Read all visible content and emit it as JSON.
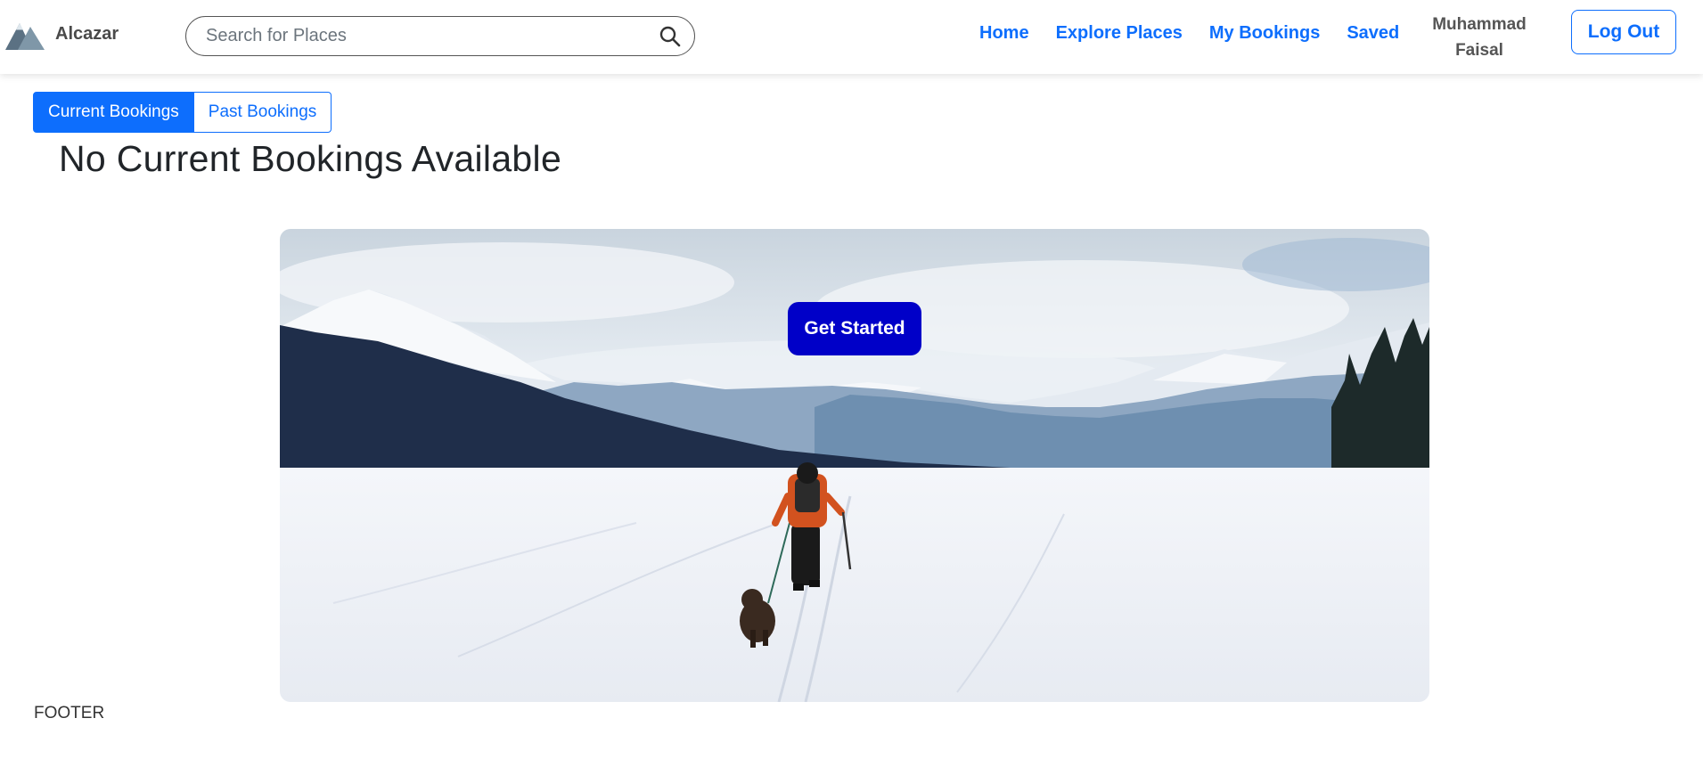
{
  "navbar": {
    "brand_name": "Alcazar",
    "search": {
      "placeholder": "Search for Places",
      "value": ""
    },
    "links": [
      "Home",
      "Explore Places",
      "My Bookings",
      "Saved"
    ],
    "user_name": "Muhammad Faisal",
    "logout_label": "Log Out"
  },
  "tabs": [
    "Current Bookings",
    "Past Bookings"
  ],
  "active_tab": "Current Bookings",
  "main": {
    "title": "No Current Bookings Available",
    "cta_label": "Get Started"
  },
  "footer": {
    "text": "FOOTER"
  },
  "colors": {
    "primary": "#0d6efd",
    "cta": "#0000c8"
  },
  "icons": {
    "brand": "mountain-logo-icon",
    "search": "search-icon"
  }
}
